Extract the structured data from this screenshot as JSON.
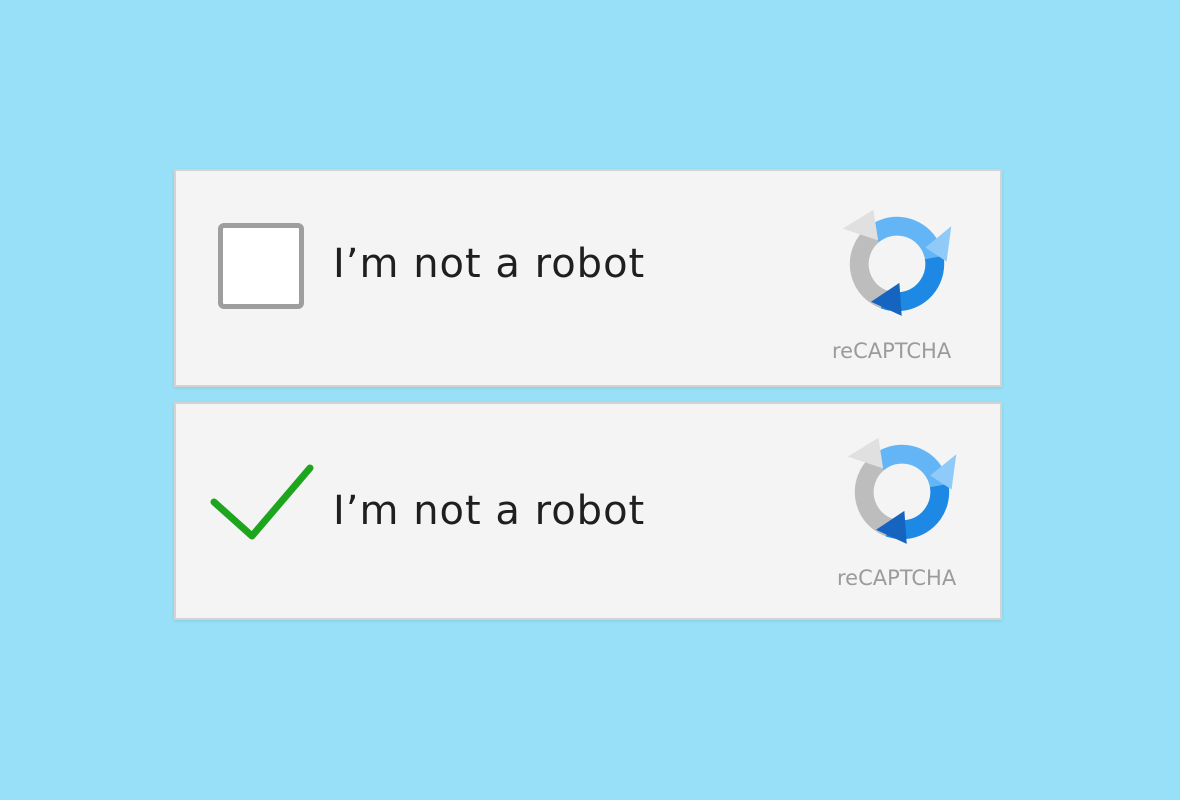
{
  "colors": {
    "page_background": "#97e0f8",
    "widget_background": "#f4f4f4",
    "checkmark": "#1ea51e",
    "logo_blue": "#1e88e5",
    "logo_light_blue": "#64b5f6",
    "logo_grey": "#bdbdbd"
  },
  "captcha_unchecked": {
    "state": "unchecked",
    "label": "I’m not a robot",
    "brand": "reCAPTCHA",
    "icon": "recaptcha-logo-icon"
  },
  "captcha_checked": {
    "state": "checked",
    "label": "I’m not a robot",
    "brand": "reCAPTCHA",
    "icon": "checkmark-icon"
  }
}
